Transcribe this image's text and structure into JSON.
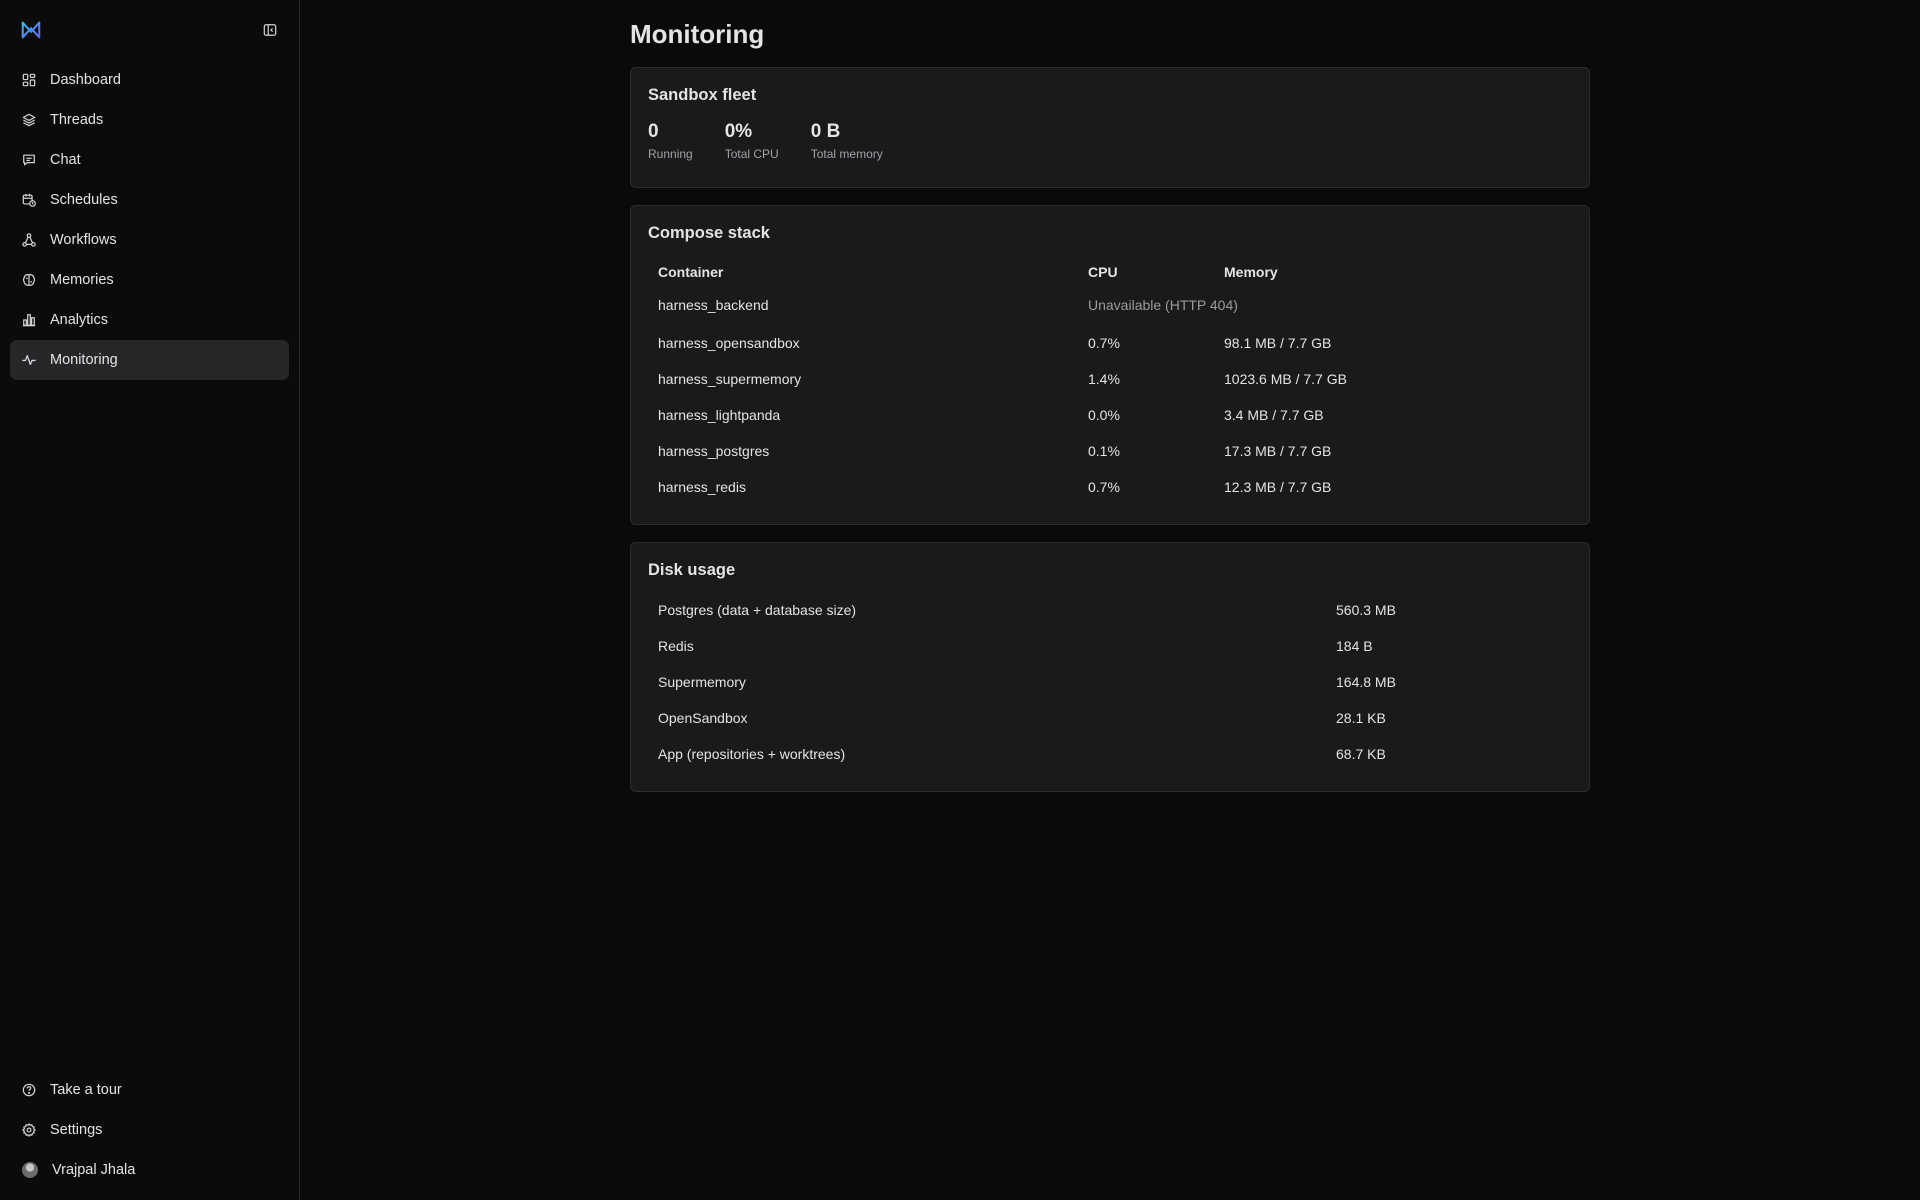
{
  "sidebar": {
    "nav": [
      {
        "label": "Dashboard",
        "icon": "dashboard-grid-icon"
      },
      {
        "label": "Threads",
        "icon": "layers-icon"
      },
      {
        "label": "Chat",
        "icon": "chat-bubble-icon"
      },
      {
        "label": "Schedules",
        "icon": "calendar-clock-icon"
      },
      {
        "label": "Workflows",
        "icon": "workflow-icon"
      },
      {
        "label": "Memories",
        "icon": "brain-icon"
      },
      {
        "label": "Analytics",
        "icon": "bar-chart-icon"
      },
      {
        "label": "Monitoring",
        "icon": "activity-icon",
        "active": true
      }
    ],
    "bottom": [
      {
        "label": "Take a tour",
        "icon": "help-circle-icon"
      },
      {
        "label": "Settings",
        "icon": "gear-icon"
      },
      {
        "label": "Vrajpal Jhala",
        "icon": "avatar"
      }
    ]
  },
  "page": {
    "title": "Monitoring"
  },
  "fleet": {
    "title": "Sandbox fleet",
    "stats": [
      {
        "value": "0",
        "label": "Running"
      },
      {
        "value": "0%",
        "label": "Total CPU"
      },
      {
        "value": "0 B",
        "label": "Total memory"
      }
    ]
  },
  "compose": {
    "title": "Compose stack",
    "columns": [
      "Container",
      "CPU",
      "Memory"
    ],
    "rows": [
      {
        "container": "harness_backend",
        "unavailable": "Unavailable (HTTP 404)"
      },
      {
        "container": "harness_opensandbox",
        "cpu": "0.7%",
        "memory": "98.1 MB / 7.7 GB"
      },
      {
        "container": "harness_supermemory",
        "cpu": "1.4%",
        "memory": "1023.6 MB / 7.7 GB"
      },
      {
        "container": "harness_lightpanda",
        "cpu": "0.0%",
        "memory": "3.4 MB / 7.7 GB"
      },
      {
        "container": "harness_postgres",
        "cpu": "0.1%",
        "memory": "17.3 MB / 7.7 GB"
      },
      {
        "container": "harness_redis",
        "cpu": "0.7%",
        "memory": "12.3 MB / 7.7 GB"
      }
    ]
  },
  "disk": {
    "title": "Disk usage",
    "rows": [
      {
        "name": "Postgres (data + database size)",
        "size": "560.3 MB"
      },
      {
        "name": "Redis",
        "size": "184 B"
      },
      {
        "name": "Supermemory",
        "size": "164.8 MB"
      },
      {
        "name": "OpenSandbox",
        "size": "28.1 KB"
      },
      {
        "name": "App (repositories + worktrees)",
        "size": "68.7 KB"
      }
    ]
  },
  "colors": {
    "background": "#0a0a0a",
    "card": "#1a1a1a",
    "active": "#27272a",
    "logo": "#38bdf8"
  }
}
